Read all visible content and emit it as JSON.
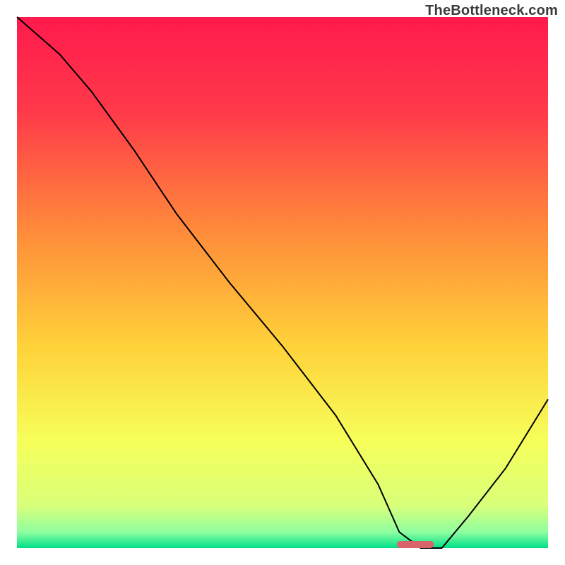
{
  "watermark": "TheBottleneck.com",
  "chart_data": {
    "type": "line",
    "title": "",
    "xlabel": "",
    "ylabel": "",
    "xlim": [
      0,
      100
    ],
    "ylim": [
      0,
      100
    ],
    "grid": false,
    "legend": false,
    "marker": {
      "x": 75,
      "width": 7,
      "color": "#d9636b"
    },
    "gradient_stops": [
      {
        "offset": 0.0,
        "color": "#ff1a4d"
      },
      {
        "offset": 0.18,
        "color": "#ff3a4a"
      },
      {
        "offset": 0.4,
        "color": "#ff8a3a"
      },
      {
        "offset": 0.62,
        "color": "#ffd23a"
      },
      {
        "offset": 0.8,
        "color": "#f6ff5a"
      },
      {
        "offset": 0.92,
        "color": "#d9ff7a"
      },
      {
        "offset": 0.97,
        "color": "#8effa0"
      },
      {
        "offset": 1.0,
        "color": "#00e08a"
      }
    ],
    "series": [
      {
        "name": "bottleneck_curve",
        "x": [
          0,
          8,
          14,
          22,
          30,
          40,
          50,
          60,
          68,
          72,
          76,
          80,
          85,
          92,
          100
        ],
        "y": [
          100,
          93,
          86,
          75,
          63,
          50,
          38,
          25,
          12,
          3,
          0,
          0,
          6,
          15,
          28
        ]
      }
    ]
  }
}
